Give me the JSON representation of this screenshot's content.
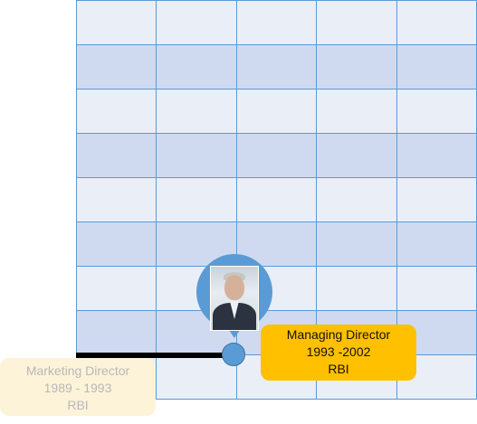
{
  "grid": {
    "columns": 5,
    "rows": 9
  },
  "colors": {
    "grid_line": "#5b9bd5",
    "row_light": "#e9eef7",
    "row_dark": "#cfdaf0",
    "marker": "#5b9bd5",
    "active_card": "#ffc000",
    "faded_card": "#fdf3d9"
  },
  "timeline": {
    "current": {
      "title": "Managing Director",
      "period": "1993 -2002",
      "company": "RBI"
    },
    "previous": {
      "title": "Marketing Director",
      "period": "1989 - 1993",
      "company": "RBI"
    }
  },
  "marker": {
    "icon": "person-photo"
  }
}
